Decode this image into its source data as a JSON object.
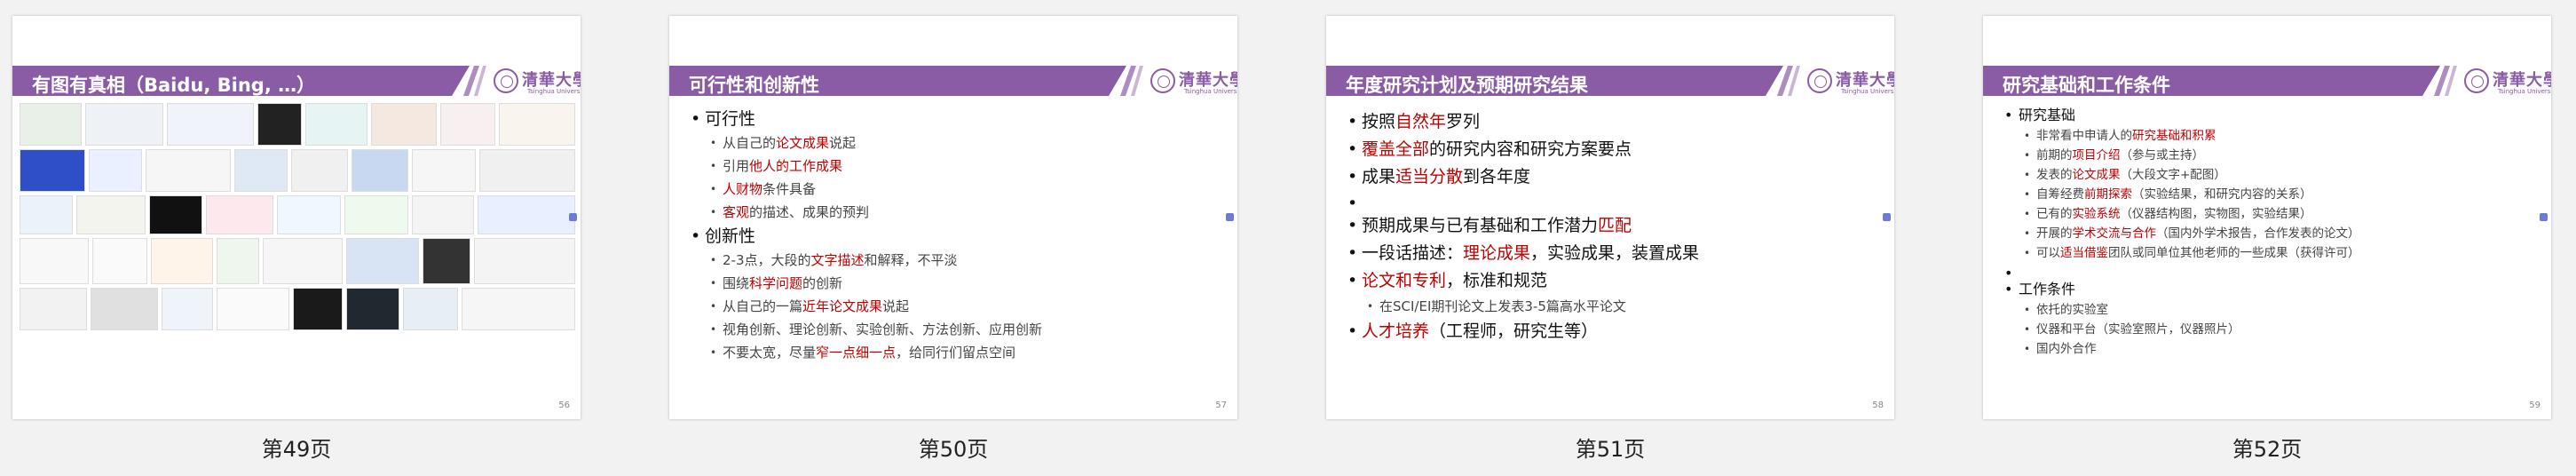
{
  "brand": {
    "accent": "#8a5ca6",
    "highlight": "#c00000",
    "logo_name": "清華大學",
    "logo_sub": "Tsinghua University"
  },
  "slides": [
    {
      "caption": "第49页",
      "title": "有图有真相（Baidu, Bing, …）",
      "page_number": "56"
    },
    {
      "caption": "第50页",
      "title": "可行性和创新性",
      "page_number": "57",
      "items": [
        {
          "text": "可行性",
          "sub": [
            {
              "pre": "从自己的",
              "hl": "论文成果",
              "post": "说起"
            },
            {
              "pre": "引用",
              "hl": "他人的工作成果",
              "post": ""
            },
            {
              "pre": "",
              "hl": "人财物",
              "post": "条件具备"
            },
            {
              "pre": "",
              "hl": "客观",
              "post": "的描述、成果的预判"
            }
          ]
        },
        {
          "text": "创新性",
          "sub": [
            {
              "pre": "2-3点，大段的",
              "hl": "文字描述",
              "post": "和解释，不平淡"
            },
            {
              "pre": "围绕",
              "hl": "科学问题",
              "post": "的创新"
            },
            {
              "pre": "从自己的一篇",
              "hl": "近年论文成果",
              "post": "说起"
            },
            {
              "pre": "视角创新、理论创新、实验创新、方法创新、应用创新",
              "hl": "",
              "post": ""
            },
            {
              "pre": "不要太宽，尽量",
              "hl": "窄一点细一点",
              "post": "，给同行们留点空间"
            }
          ]
        }
      ]
    },
    {
      "caption": "第51页",
      "title": "年度研究计划及预期研究结果",
      "page_number": "58",
      "items": [
        {
          "pre": "按照",
          "hl": "自然年",
          "post": "罗列"
        },
        {
          "pre": "",
          "hl": "覆盖全部",
          "post": "的研究内容和研究方案要点"
        },
        {
          "pre": "成果",
          "hl": "适当分散",
          "post": "到各年度"
        },
        {
          "pre": "预期成果与已有基础和工作潜力",
          "hl": "匹配",
          "post": ""
        },
        {
          "pre": "一段话描述：",
          "hl": "理论成果",
          "post": "，实验成果，装置成果"
        },
        {
          "pre": "",
          "hl": "论文和专利",
          "post": "，标准和规范"
        },
        {
          "pre": "",
          "hl": "人才培养",
          "post": "（工程师，研究生等）"
        }
      ],
      "sub_item": "在SCI/EI期刊论文上发表3-5篇高水平论文"
    },
    {
      "caption": "第52页",
      "title": "研究基础和工作条件",
      "page_number": "59",
      "items": [
        {
          "text": "研究基础",
          "sub": [
            {
              "pre": "非常看中申请人的",
              "hl": "研究基础和积累",
              "post": ""
            },
            {
              "pre": "前期的",
              "hl": "项目介绍",
              "post": "（参与或主持）"
            },
            {
              "pre": "发表的",
              "hl": "论文成果",
              "post": "（大段文字+配图）"
            },
            {
              "pre": "自筹经费",
              "hl": "前期探索",
              "post": "（实验结果，和研究内容的关系）"
            },
            {
              "pre": "已有的",
              "hl": "实验系统",
              "post": "（仪器结构图，实物图，实验结果）"
            },
            {
              "pre": "开展的",
              "hl": "学术交流与合作",
              "post": "（国内外学术报告，合作发表的论文）"
            },
            {
              "pre": "可以",
              "hl": "适当借鉴",
              "post": "团队或同单位其他老师的一些成果（获得许可）"
            }
          ]
        },
        {
          "text": "工作条件",
          "sub": [
            {
              "pre": "依托的实验室",
              "hl": "",
              "post": ""
            },
            {
              "pre": "仪器和平台（实验室照片，仪器照片）",
              "hl": "",
              "post": ""
            },
            {
              "pre": "国内外合作",
              "hl": "",
              "post": ""
            }
          ]
        }
      ]
    }
  ]
}
